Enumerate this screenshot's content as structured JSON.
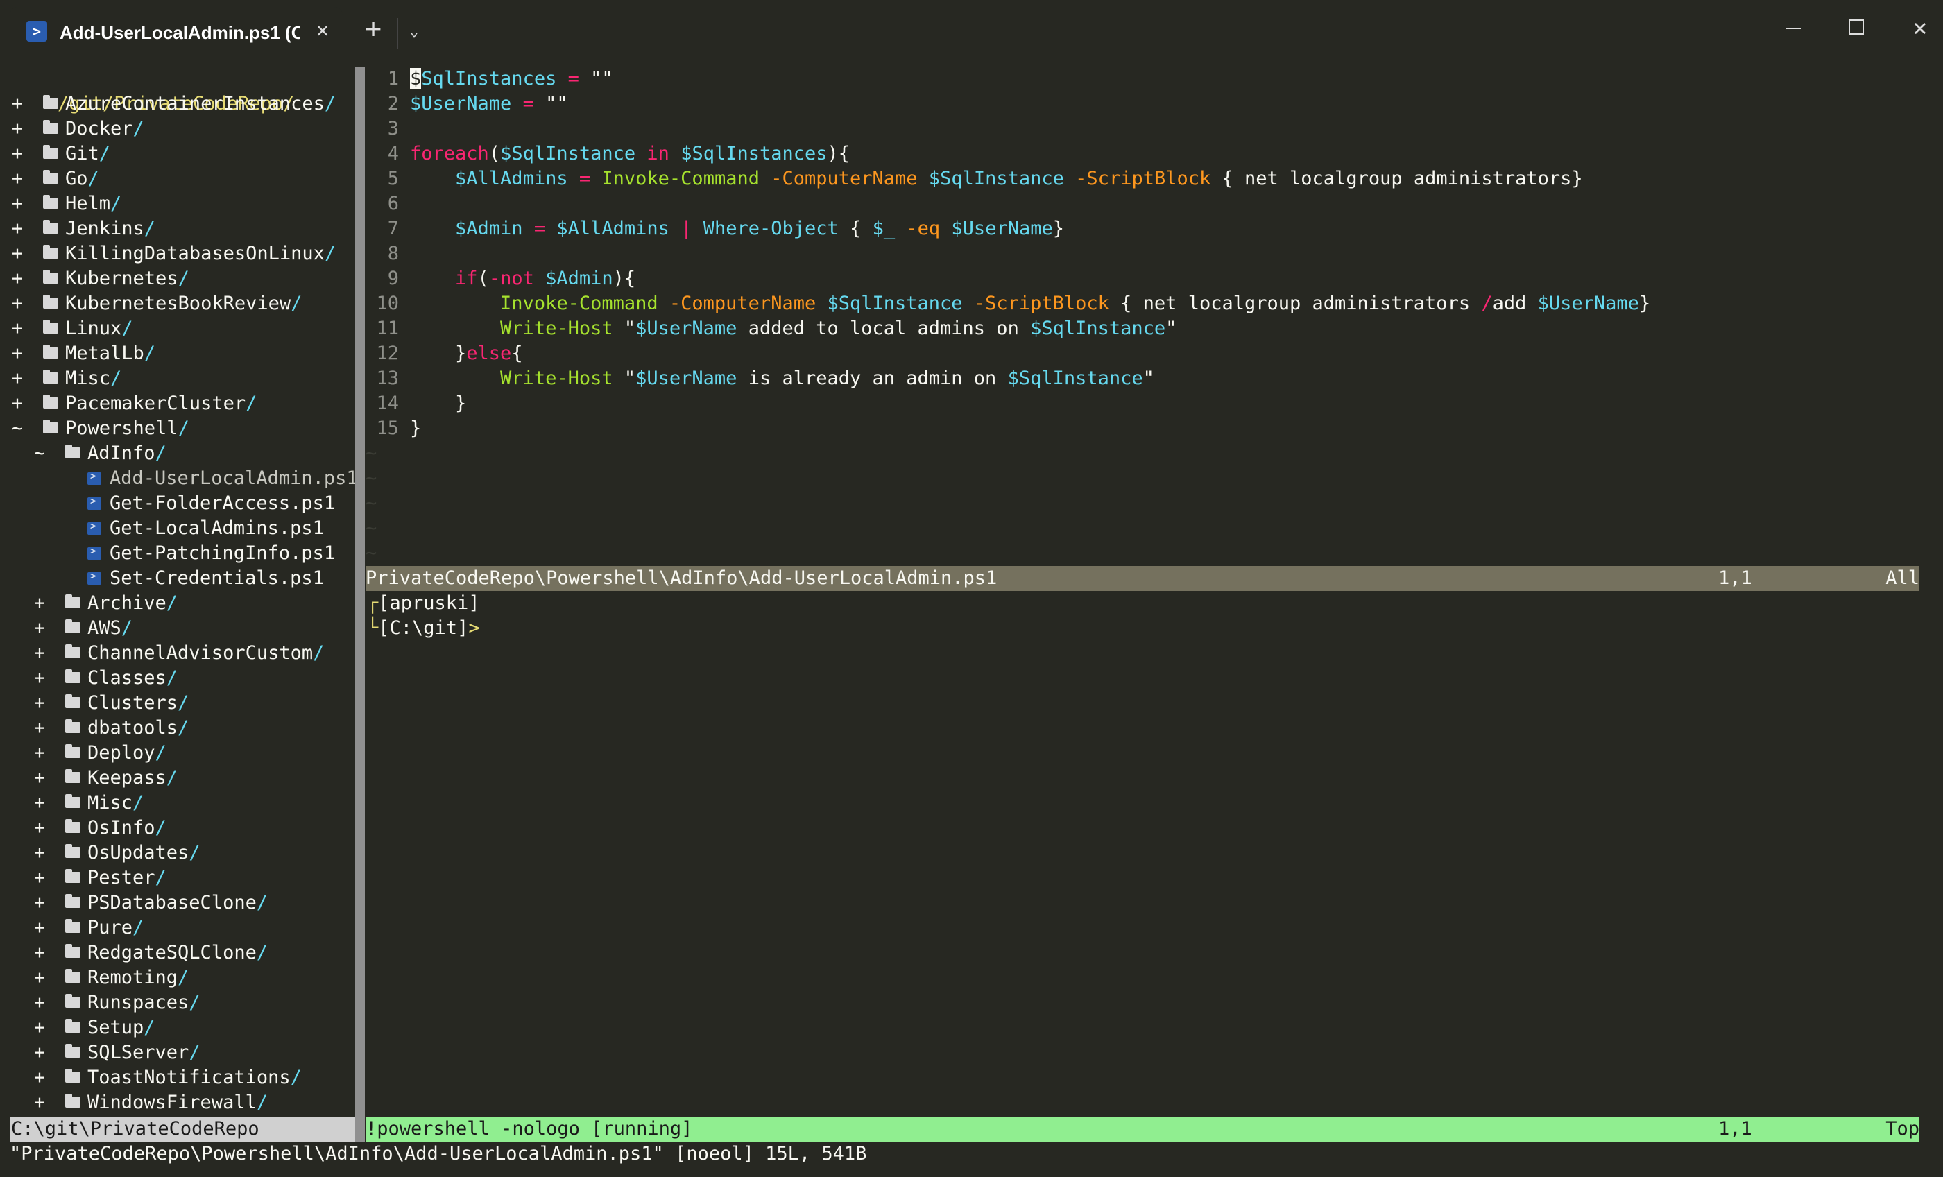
{
  "window": {
    "tab_title": "Add-UserLocalAdmin.ps1 (C:\\g",
    "tab_icon": "powershell-icon",
    "new_tab": "+",
    "dropdown": "⌄",
    "close": "✕"
  },
  "tree": {
    "root": "/git/PrivateCodeRepo/",
    "items": [
      {
        "sign": "+",
        "name": "AzureContainerInstances",
        "type": "folder",
        "level": 0
      },
      {
        "sign": "+",
        "name": "Docker",
        "type": "folder",
        "level": 0
      },
      {
        "sign": "+",
        "name": "Git",
        "type": "folder",
        "level": 0
      },
      {
        "sign": "+",
        "name": "Go",
        "type": "folder",
        "level": 0
      },
      {
        "sign": "+",
        "name": "Helm",
        "type": "folder",
        "level": 0
      },
      {
        "sign": "+",
        "name": "Jenkins",
        "type": "folder",
        "level": 0
      },
      {
        "sign": "+",
        "name": "KillingDatabasesOnLinux",
        "type": "folder",
        "level": 0
      },
      {
        "sign": "+",
        "name": "Kubernetes",
        "type": "folder",
        "level": 0
      },
      {
        "sign": "+",
        "name": "KubernetesBookReview",
        "type": "folder",
        "level": 0
      },
      {
        "sign": "+",
        "name": "Linux",
        "type": "folder",
        "level": 0
      },
      {
        "sign": "+",
        "name": "MetalLb",
        "type": "folder",
        "level": 0
      },
      {
        "sign": "+",
        "name": "Misc",
        "type": "folder",
        "level": 0
      },
      {
        "sign": "+",
        "name": "PacemakerCluster",
        "type": "folder",
        "level": 0
      },
      {
        "sign": "~",
        "name": "Powershell",
        "type": "folder",
        "level": 0
      },
      {
        "sign": "~",
        "name": "AdInfo",
        "type": "folder",
        "level": 1
      },
      {
        "sign": "",
        "name": "Add-UserLocalAdmin.ps1",
        "type": "file",
        "level": 2,
        "active": true
      },
      {
        "sign": "",
        "name": "Get-FolderAccess.ps1",
        "type": "file",
        "level": 2
      },
      {
        "sign": "",
        "name": "Get-LocalAdmins.ps1",
        "type": "file",
        "level": 2
      },
      {
        "sign": "",
        "name": "Get-PatchingInfo.ps1",
        "type": "file",
        "level": 2
      },
      {
        "sign": "",
        "name": "Set-Credentials.ps1",
        "type": "file",
        "level": 2
      },
      {
        "sign": "+",
        "name": "Archive",
        "type": "folder",
        "level": 1
      },
      {
        "sign": "+",
        "name": "AWS",
        "type": "folder",
        "level": 1
      },
      {
        "sign": "+",
        "name": "ChannelAdvisorCustom",
        "type": "folder",
        "level": 1
      },
      {
        "sign": "+",
        "name": "Classes",
        "type": "folder",
        "level": 1
      },
      {
        "sign": "+",
        "name": "Clusters",
        "type": "folder",
        "level": 1
      },
      {
        "sign": "+",
        "name": "dbatools",
        "type": "folder",
        "level": 1
      },
      {
        "sign": "+",
        "name": "Deploy",
        "type": "folder",
        "level": 1
      },
      {
        "sign": "+",
        "name": "Keepass",
        "type": "folder",
        "level": 1
      },
      {
        "sign": "+",
        "name": "Misc",
        "type": "folder",
        "level": 1
      },
      {
        "sign": "+",
        "name": "OsInfo",
        "type": "folder",
        "level": 1
      },
      {
        "sign": "+",
        "name": "OsUpdates",
        "type": "folder",
        "level": 1
      },
      {
        "sign": "+",
        "name": "Pester",
        "type": "folder",
        "level": 1
      },
      {
        "sign": "+",
        "name": "PSDatabaseClone",
        "type": "folder",
        "level": 1
      },
      {
        "sign": "+",
        "name": "Pure",
        "type": "folder",
        "level": 1
      },
      {
        "sign": "+",
        "name": "RedgateSQLClone",
        "type": "folder",
        "level": 1
      },
      {
        "sign": "+",
        "name": "Remoting",
        "type": "folder",
        "level": 1
      },
      {
        "sign": "+",
        "name": "Runspaces",
        "type": "folder",
        "level": 1
      },
      {
        "sign": "+",
        "name": "Setup",
        "type": "folder",
        "level": 1
      },
      {
        "sign": "+",
        "name": "SQLServer",
        "type": "folder",
        "level": 1
      },
      {
        "sign": "+",
        "name": "ToastNotifications",
        "type": "folder",
        "level": 1
      },
      {
        "sign": "+",
        "name": "WindowsFirewall",
        "type": "folder",
        "level": 1
      }
    ],
    "status": "C:\\git\\PrivateCodeRepo"
  },
  "editor": {
    "lines": [
      [
        [
          "var",
          "$SqlInstances"
        ],
        [
          "txt",
          " "
        ],
        [
          "op",
          "="
        ],
        [
          "txt",
          " \"\""
        ]
      ],
      [
        [
          "var",
          "$UserName"
        ],
        [
          "txt",
          " "
        ],
        [
          "op",
          "="
        ],
        [
          "txt",
          " \"\""
        ]
      ],
      [],
      [
        [
          "kw",
          "foreach"
        ],
        [
          "txt",
          "("
        ],
        [
          "var",
          "$SqlInstance"
        ],
        [
          "txt",
          " "
        ],
        [
          "kw",
          "in"
        ],
        [
          "txt",
          " "
        ],
        [
          "var",
          "$SqlInstances"
        ],
        [
          "txt",
          "){"
        ]
      ],
      [
        [
          "txt",
          "    "
        ],
        [
          "var",
          "$AllAdmins"
        ],
        [
          "txt",
          " "
        ],
        [
          "op",
          "="
        ],
        [
          "txt",
          " "
        ],
        [
          "cmd",
          "Invoke-Command"
        ],
        [
          "txt",
          " "
        ],
        [
          "param",
          "-ComputerName"
        ],
        [
          "txt",
          " "
        ],
        [
          "var",
          "$SqlInstance"
        ],
        [
          "txt",
          " "
        ],
        [
          "param",
          "-ScriptBlock"
        ],
        [
          "txt",
          " { net localgroup administrators}"
        ]
      ],
      [],
      [
        [
          "txt",
          "    "
        ],
        [
          "var",
          "$Admin"
        ],
        [
          "txt",
          " "
        ],
        [
          "op",
          "="
        ],
        [
          "txt",
          " "
        ],
        [
          "var",
          "$AllAdmins"
        ],
        [
          "txt",
          " "
        ],
        [
          "op",
          "|"
        ],
        [
          "txt",
          " "
        ],
        [
          "var",
          "Where-Object"
        ],
        [
          "txt",
          " { "
        ],
        [
          "var",
          "$_"
        ],
        [
          "txt",
          " "
        ],
        [
          "param",
          "-eq"
        ],
        [
          "txt",
          " "
        ],
        [
          "var",
          "$UserName"
        ],
        [
          "txt",
          "}"
        ]
      ],
      [],
      [
        [
          "txt",
          "    "
        ],
        [
          "kw",
          "if"
        ],
        [
          "txt",
          "("
        ],
        [
          "kw",
          "-not"
        ],
        [
          "txt",
          " "
        ],
        [
          "var",
          "$Admin"
        ],
        [
          "txt",
          "){"
        ]
      ],
      [
        [
          "txt",
          "        "
        ],
        [
          "cmd",
          "Invoke-Command"
        ],
        [
          "txt",
          " "
        ],
        [
          "param",
          "-ComputerName"
        ],
        [
          "txt",
          " "
        ],
        [
          "var",
          "$SqlInstance"
        ],
        [
          "txt",
          " "
        ],
        [
          "param",
          "-ScriptBlock"
        ],
        [
          "txt",
          " { net localgroup administrators "
        ],
        [
          "op",
          "/"
        ],
        [
          "txt",
          "add "
        ],
        [
          "var",
          "$UserName"
        ],
        [
          "txt",
          "}"
        ]
      ],
      [
        [
          "txt",
          "        "
        ],
        [
          "cmd",
          "Write-Host"
        ],
        [
          "txt",
          " \""
        ],
        [
          "var",
          "$UserName"
        ],
        [
          "txt",
          " added to local admins on "
        ],
        [
          "var",
          "$SqlInstance"
        ],
        [
          "txt",
          "\""
        ]
      ],
      [
        [
          "txt",
          "    }"
        ],
        [
          "kw",
          "else"
        ],
        [
          "txt",
          "{"
        ]
      ],
      [
        [
          "txt",
          "        "
        ],
        [
          "cmd",
          "Write-Host"
        ],
        [
          "txt",
          " \""
        ],
        [
          "var",
          "$UserName"
        ],
        [
          "txt",
          " is already an admin on "
        ],
        [
          "var",
          "$SqlInstance"
        ],
        [
          "txt",
          "\""
        ]
      ],
      [
        [
          "txt",
          "    }"
        ]
      ],
      [
        [
          "txt",
          "}"
        ]
      ]
    ],
    "line_numbers": [
      "1",
      "2",
      "3",
      "4",
      "5",
      "6",
      "7",
      "8",
      "9",
      "10",
      "11",
      "12",
      "13",
      "14",
      "15"
    ],
    "tilde_count": 5,
    "status": {
      "file": "PrivateCodeRepo\\Powershell\\AdInfo\\Add-UserLocalAdmin.ps1",
      "pos": "1,1",
      "pct": "All"
    }
  },
  "terminal": {
    "line1_bracket": "┌",
    "line1_text": "[apruski]",
    "line2_bracket": "└",
    "line2_text": "[C:\\git]",
    "prompt": ">",
    "status": {
      "cmd": "!powershell -nologo [running]",
      "pos": "1,1",
      "pct": "Top"
    }
  },
  "cmdline": "\"PrivateCodeRepo\\Powershell\\AdInfo\\Add-UserLocalAdmin.ps1\" [noeol] 15L, 541B",
  "colors": {
    "background": "#272822",
    "variable": "#66d9ef",
    "keyword": "#f92672",
    "cmdlet": "#a6e22e",
    "parameter": "#fd971f",
    "terminal_status": "#90ee90"
  }
}
